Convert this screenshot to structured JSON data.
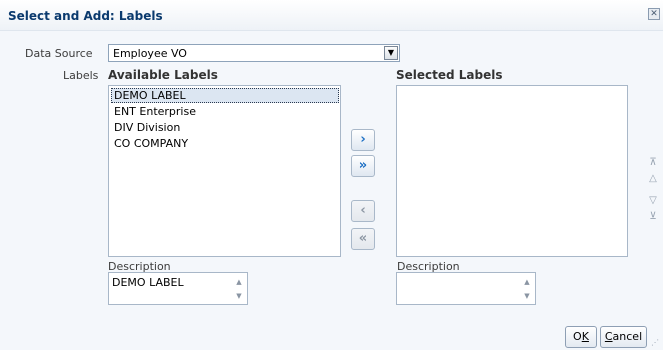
{
  "dialog": {
    "title": "Select and Add: Labels",
    "close_glyph": "✕"
  },
  "data_source": {
    "label": "Data Source",
    "value": "Employee VO"
  },
  "labels_field": {
    "label": "Labels"
  },
  "available": {
    "heading": "Available Labels",
    "items": [
      "DEMO LABEL",
      "ENT Enterprise",
      "DIV Division",
      "CO COMPANY"
    ],
    "selected_index": 0,
    "description_label": "Description",
    "description_value": "DEMO LABEL"
  },
  "selected": {
    "heading": "Selected Labels",
    "items": [],
    "description_label": "Description",
    "description_value": ""
  },
  "shuttle": {
    "move": "›",
    "move_all": "»",
    "remove": "‹",
    "remove_all": "«"
  },
  "reorder": {
    "top": "⊼",
    "up": "△",
    "down": "▽",
    "bottom": "⊻"
  },
  "buttons": {
    "ok_prefix": "O",
    "ok_mnemonic": "K",
    "cancel_mnemonic": "C",
    "cancel_suffix": "ancel"
  },
  "icons": {
    "dropdown": "chevron-down-icon",
    "spin_up": "spin-up-icon",
    "spin_down": "spin-down-icon"
  },
  "colors": {
    "title": "#0b3a6e",
    "accent": "#1d6fc4",
    "selection": "#dce6f2"
  }
}
